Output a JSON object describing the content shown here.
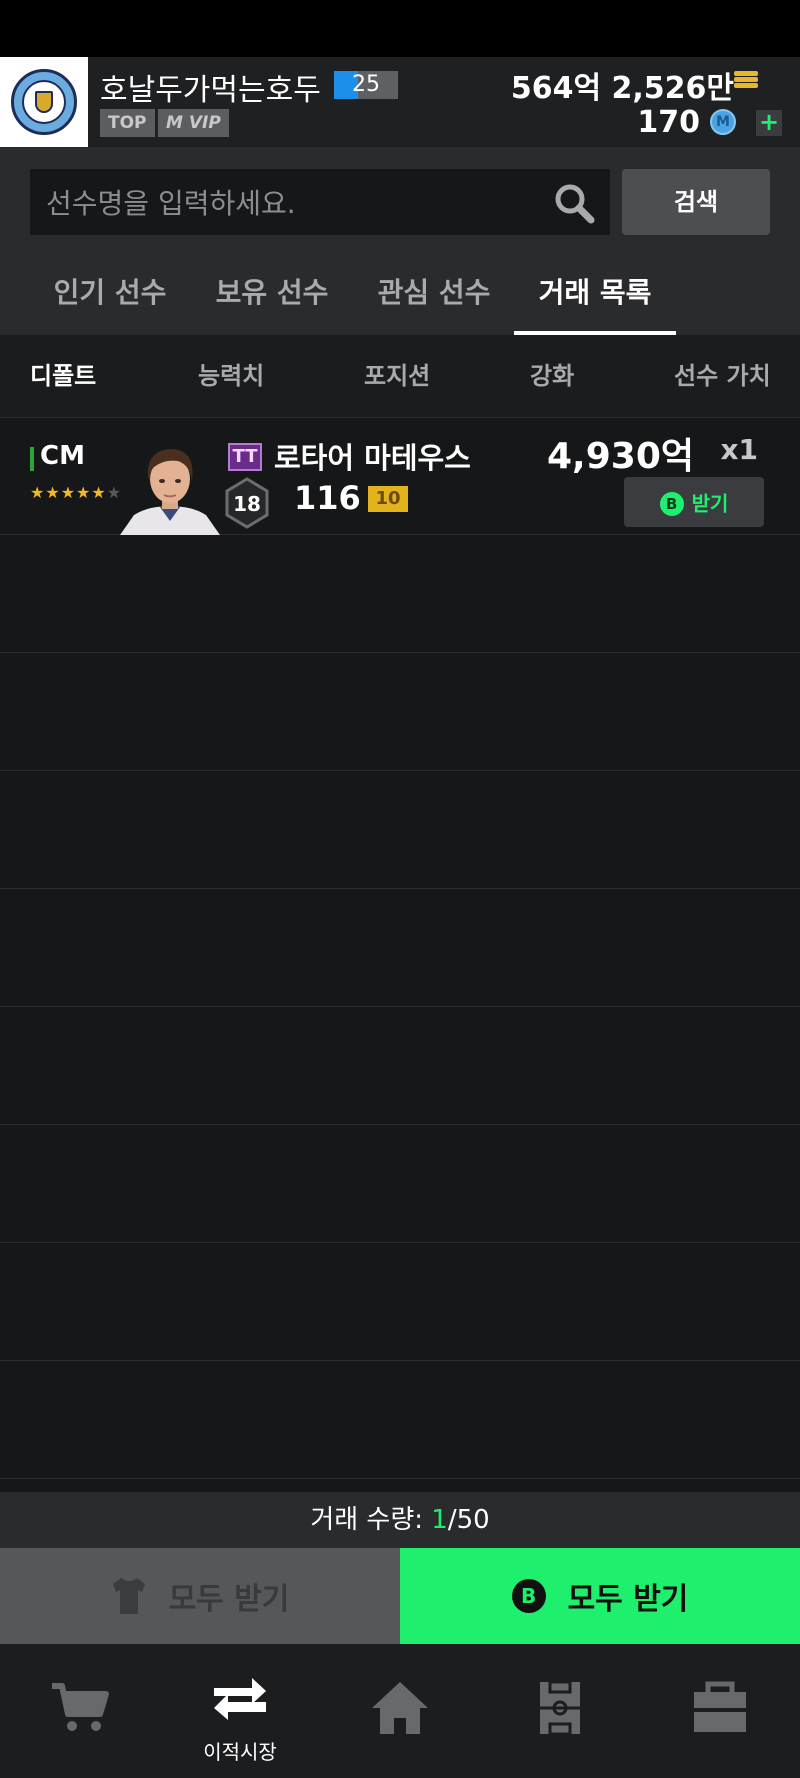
{
  "header": {
    "nickname": "호날두가먹는호두",
    "level": "25",
    "level_progress": 0.38,
    "badge_top": "TOP",
    "badge_vip": "M VIP",
    "bp_amount": "564억 2,526만",
    "fc_amount": "170",
    "fc_icon_letter": "M",
    "plus": "+"
  },
  "search": {
    "placeholder": "선수명을 입력하세요.",
    "button_label": "검색"
  },
  "tabs": [
    {
      "label": "인기 선수",
      "active": false
    },
    {
      "label": "보유 선수",
      "active": false
    },
    {
      "label": "관심 선수",
      "active": false
    },
    {
      "label": "거래 목록",
      "active": true
    }
  ],
  "sort": [
    {
      "label": "디폴트",
      "active": true
    },
    {
      "label": "능력치",
      "active": false
    },
    {
      "label": "포지션",
      "active": false
    },
    {
      "label": "강화",
      "active": false
    },
    {
      "label": "선수 가치",
      "active": false
    }
  ],
  "rows": [
    {
      "position": "CM",
      "stars": 5,
      "stars_max": 6,
      "season": "TT",
      "name": "로타어 마테우스",
      "ovr_level": "18",
      "ovr": "116",
      "upgrade": "10",
      "price": "4,930억",
      "qty": "x1",
      "receive_icon": "B",
      "receive_label": "받기"
    }
  ],
  "empty_rows": 8,
  "footer": {
    "trade_label": "거래 수량: ",
    "trade_current": "1",
    "trade_max": "/50",
    "receive_all_left": "모두 받기",
    "receive_all_right": "모두 받기",
    "b_icon": "B"
  },
  "nav": [
    {
      "icon": "cart-icon",
      "label": ""
    },
    {
      "icon": "transfer-icon",
      "label": "이적시장"
    },
    {
      "icon": "home-icon",
      "label": ""
    },
    {
      "icon": "pitch-icon",
      "label": ""
    },
    {
      "icon": "bag-icon",
      "label": ""
    }
  ],
  "colors": {
    "accent_green": "#1ef06e",
    "level_blue": "#1e8fe8",
    "season_purple": "#6a2c8a",
    "upgrade_gold": "#e2b31c"
  }
}
